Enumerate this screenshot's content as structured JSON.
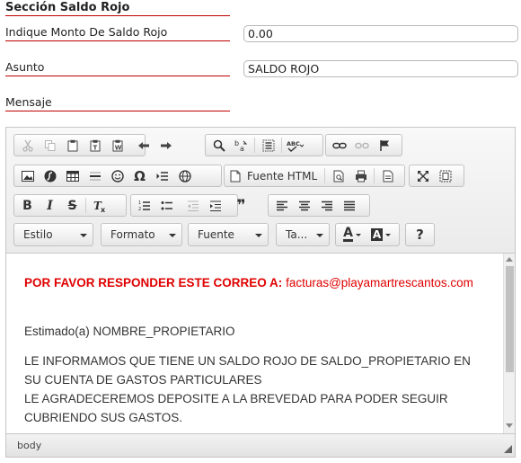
{
  "section": {
    "title": "Sección Saldo Rojo"
  },
  "monto": {
    "label": "Indique Monto De Saldo Rojo",
    "value": "0.00"
  },
  "asunto": {
    "label": "Asunto",
    "value": "SALDO ROJO"
  },
  "mensaje": {
    "label": "Mensaje"
  },
  "toolbar": {
    "source_label": "Fuente HTML",
    "styles_label": "Estilo",
    "format_label": "Formato",
    "font_label": "Fuente",
    "size_label": "Ta...",
    "bold": "B",
    "italic": "I",
    "strike": "S",
    "help": "?",
    "blockquote": "❞",
    "omega": "Ω",
    "text_color": "A",
    "bg_color": "A"
  },
  "content": {
    "header_bold": "POR FAVOR RESPONDER ESTE CORREO A:",
    "header_email": "facturas@playamartrescantos.com",
    "greeting": "Estimado(a) NOMBRE_PROPIETARIO",
    "line1": "LE INFORMAMOS QUE TIENE UN SALDO ROJO DE SALDO_PROPIETARIO EN SU CUENTA DE GASTOS PARTICULARES",
    "line2": "LE AGRADECEREMOS DEPOSITE A LA BREVEDAD PARA PODER SEGUIR CUBRIENDO SUS GASTOS."
  },
  "statusbar": {
    "path": "body"
  },
  "colors": {
    "accent_red": "#c00000",
    "content_red": "#e00000"
  }
}
